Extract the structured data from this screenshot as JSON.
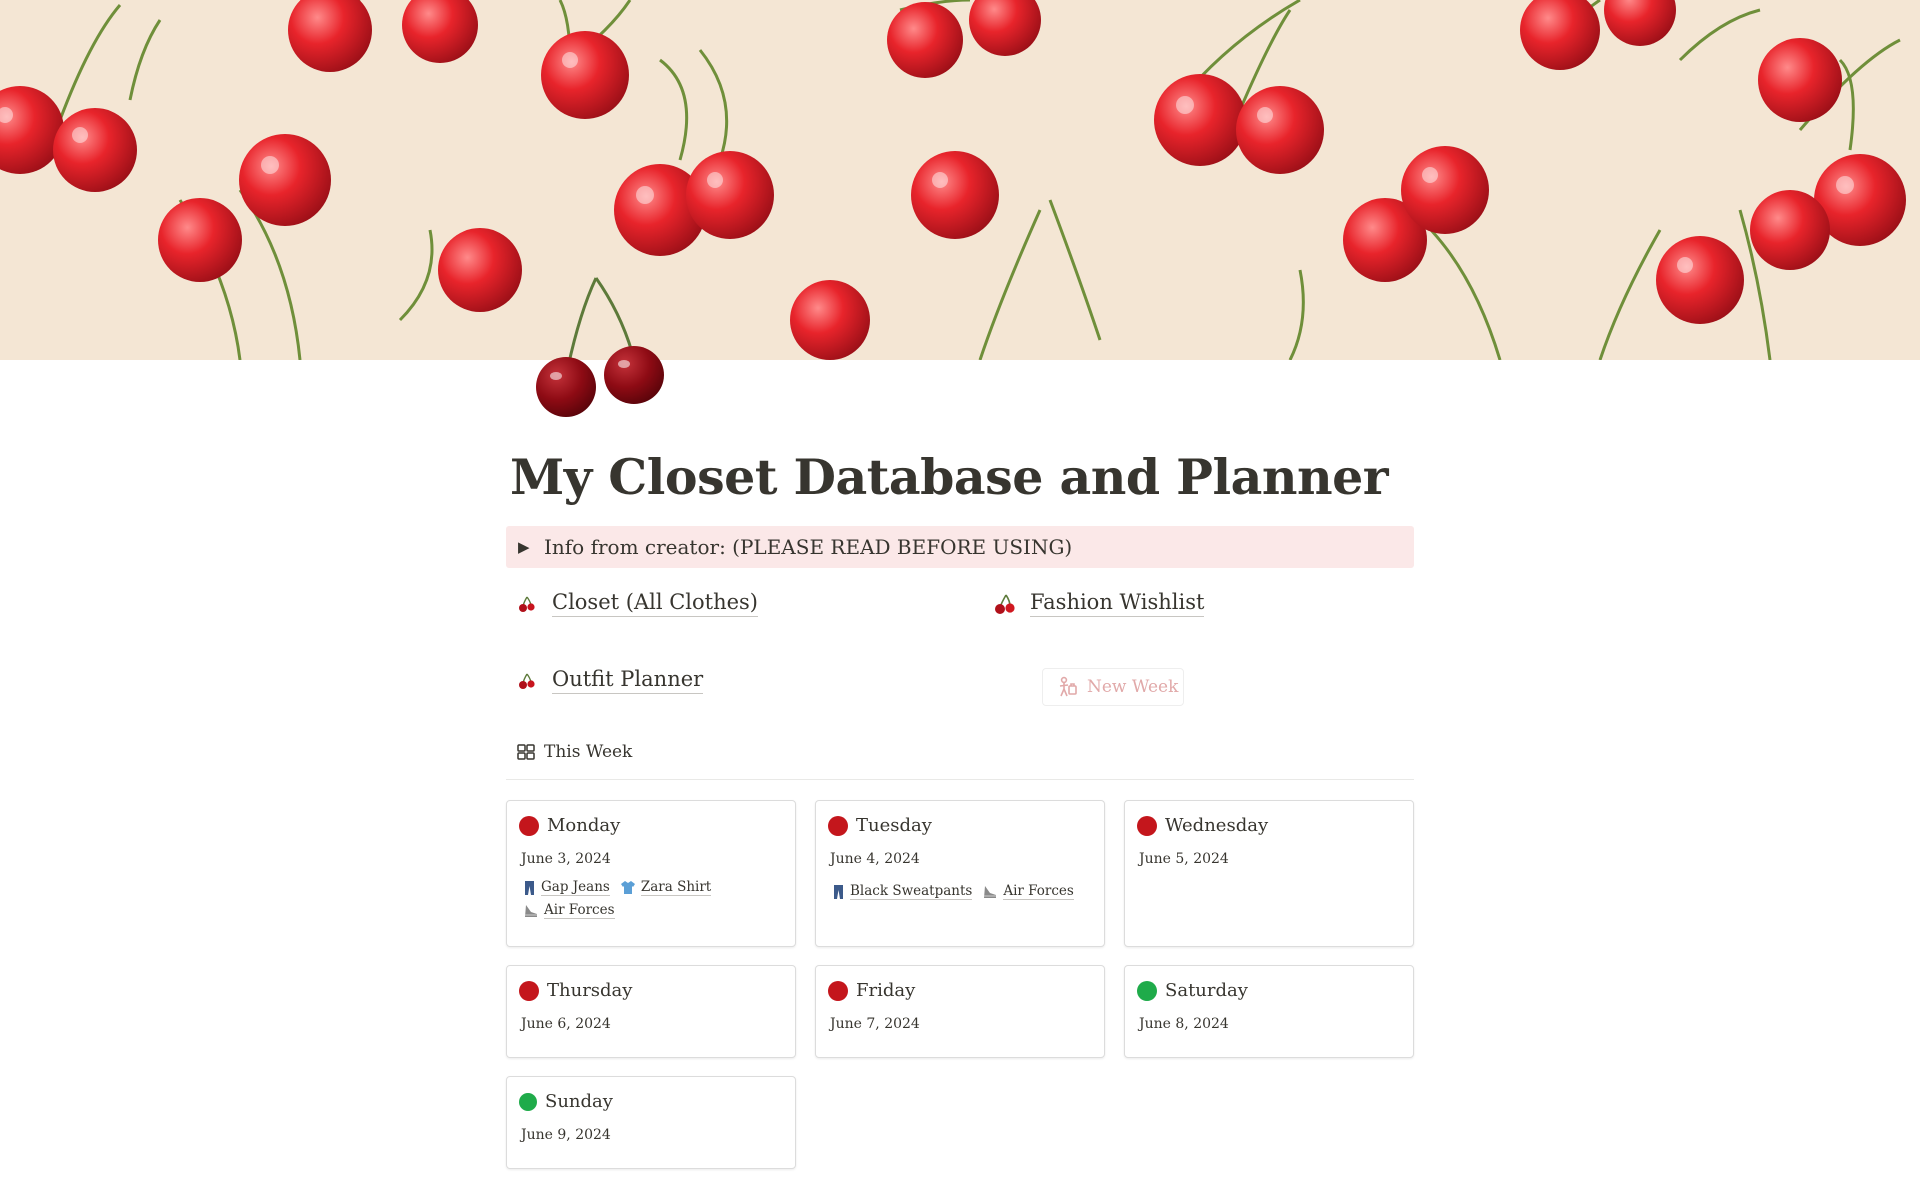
{
  "page": {
    "title": "My Closet Database and Planner",
    "icon": "cherry-icon"
  },
  "callout": {
    "text": "Info from creator: (PLEASE READ BEFORE USING)",
    "background": "#fbe8e8"
  },
  "links": {
    "closet": "Closet (All Clothes)",
    "wishlist": "Fashion Wishlist",
    "planner": "Outfit Planner",
    "new_week": "New Week"
  },
  "view": {
    "tab_label": "This Week"
  },
  "colors": {
    "red_status": "#c4161c",
    "green_status": "#1fab4a",
    "new_week_text": "#e1a9a9"
  },
  "days": [
    {
      "day": "Monday",
      "date": "June 3, 2024",
      "status": "red",
      "items": [
        {
          "label": "Gap Jeans",
          "icon": "jeans-icon"
        },
        {
          "label": "Zara Shirt",
          "icon": "shirt-icon"
        },
        {
          "label": "Air Forces",
          "icon": "sneaker-icon"
        }
      ]
    },
    {
      "day": "Tuesday",
      "date": "June 4, 2024",
      "status": "red",
      "items": [
        {
          "label": "Black Sweatpants",
          "icon": "jeans-icon"
        },
        {
          "label": "Air Forces",
          "icon": "sneaker-icon"
        }
      ]
    },
    {
      "day": "Wednesday",
      "date": "June 5, 2024",
      "status": "red",
      "items": []
    },
    {
      "day": "Thursday",
      "date": "June 6, 2024",
      "status": "red",
      "items": []
    },
    {
      "day": "Friday",
      "date": "June 7, 2024",
      "status": "red",
      "items": []
    },
    {
      "day": "Saturday",
      "date": "June 8, 2024",
      "status": "green",
      "items": []
    },
    {
      "day": "Sunday",
      "date": "June 9, 2024",
      "status": "green",
      "items": []
    }
  ]
}
